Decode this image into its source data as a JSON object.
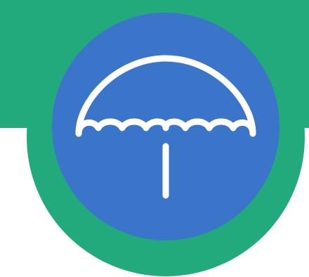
{
  "icon": {
    "name": "umbrella-icon",
    "colors": {
      "background": "#ffffff",
      "green": "#22aa7d",
      "blue": "#3a75c9",
      "white": "#ffffff"
    }
  }
}
